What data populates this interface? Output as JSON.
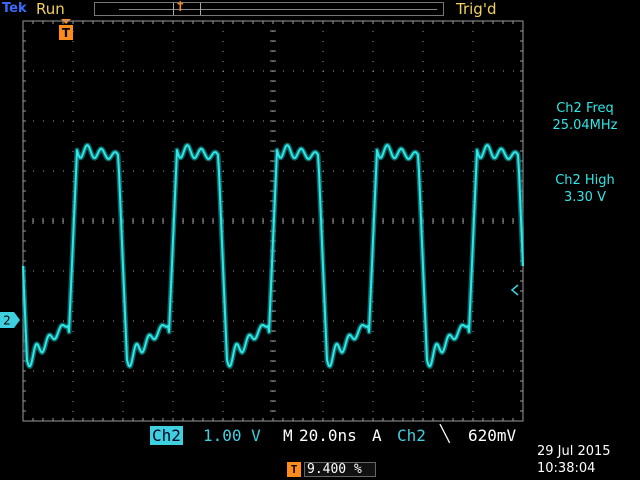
{
  "header": {
    "brand": "Tek",
    "status": "Run",
    "trigger_state": "Trig'd"
  },
  "markers": {
    "trigger_top": "T",
    "channel": "2"
  },
  "measurements": [
    {
      "label": "Ch2 Freq",
      "value": "25.04MHz"
    },
    {
      "label": "Ch2 High",
      "value": "3.30 V"
    }
  ],
  "footer": {
    "channel": "Ch2",
    "volts_per_div": "1.00 V",
    "timebase_mode": "M",
    "time_per_div": "20.0ns",
    "trigger_mode": "A",
    "trigger_source": "Ch2",
    "trigger_edge": "╲",
    "trigger_level": "620mV",
    "trigger_pos_icon": "T",
    "trigger_position": "9.400 %",
    "date": "29 Jul  2015",
    "time": "10:38:04"
  },
  "colors": {
    "trace": "#30e6e6",
    "trace_glow": "#0f8e8e",
    "grid": "#9a9a9a",
    "trigger": "#ff8c1a",
    "header_text": "#f2d060"
  },
  "icons": {
    "trigger_marker": "trigger-t-icon",
    "edge": "falling-edge-icon"
  }
}
